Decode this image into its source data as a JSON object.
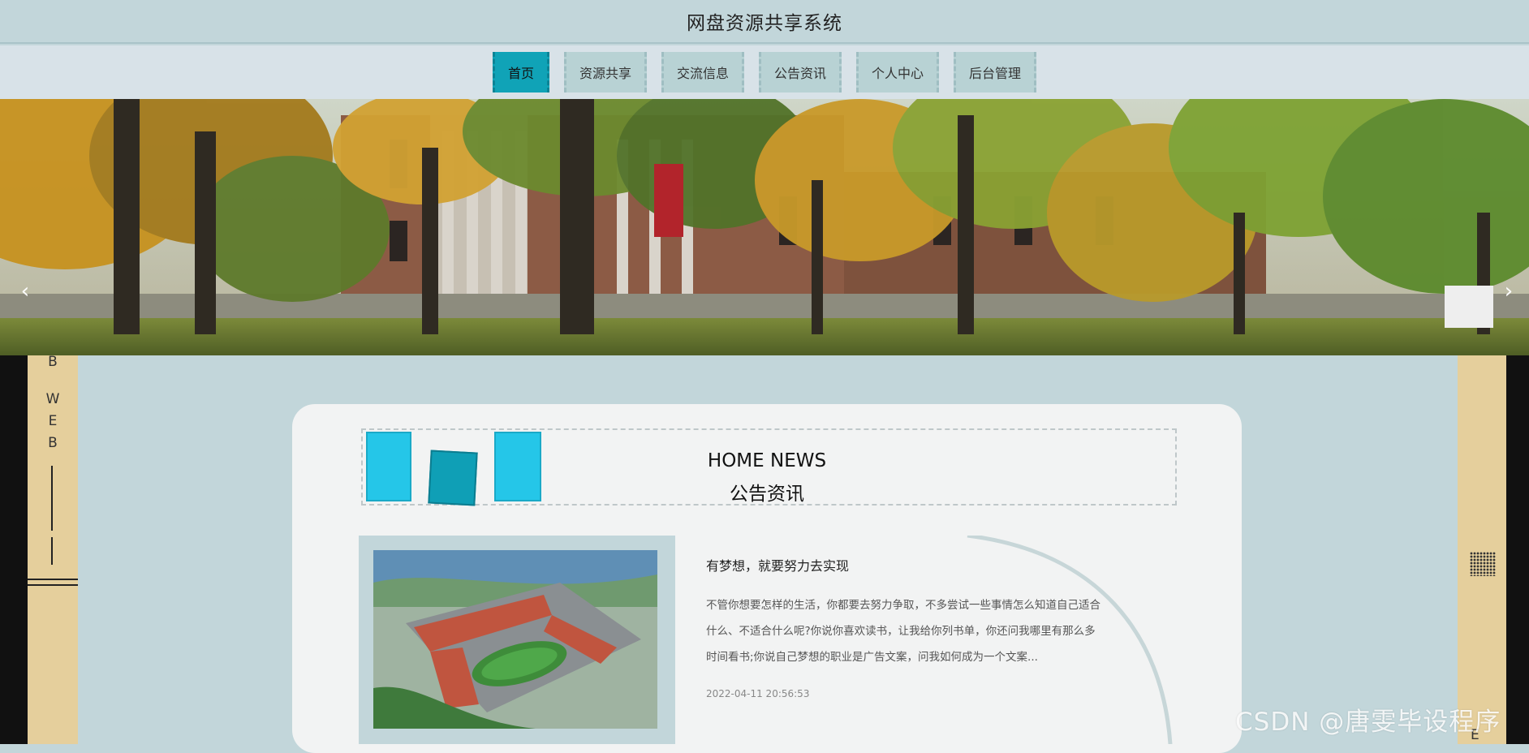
{
  "header": {
    "title": "网盘资源共享系统"
  },
  "nav": {
    "items": [
      {
        "label": "首页",
        "active": true
      },
      {
        "label": "资源共享"
      },
      {
        "label": "交流信息"
      },
      {
        "label": "公告资讯"
      },
      {
        "label": "个人中心"
      },
      {
        "label": "后台管理"
      }
    ]
  },
  "banner": {
    "prev_icon": "chevron-left-icon",
    "next_icon": "chevron-right-icon",
    "prev_glyph": "‹",
    "next_glyph": "›"
  },
  "side_left": {
    "letters": [
      "B",
      "W",
      "E",
      "B"
    ]
  },
  "side_right": {
    "letters": [
      "E"
    ]
  },
  "section": {
    "title_en": "HOME NEWS",
    "title_cn": "公告资讯"
  },
  "news": [
    {
      "title": "有梦想，就要努力去实现",
      "summary": "不管你想要怎样的生活，你都要去努力争取，不多尝试一些事情怎么知道自己适合什么、不适合什么呢?你说你喜欢读书，让我给你列书单，你还问我哪里有那么多时间看书;你说自己梦想的职业是广告文案，问我如何成为一个文案...",
      "date": "2022-04-11 20:56:53"
    }
  ],
  "watermark": "CSDN @唐雯毕设程序",
  "colors": {
    "page_bg": "#c2d6da",
    "nav_active": "#10a3b7",
    "nav_item": "#b8d2d4",
    "accent_tan": "#e5cf9c",
    "book_blue": "#25c6e8"
  }
}
